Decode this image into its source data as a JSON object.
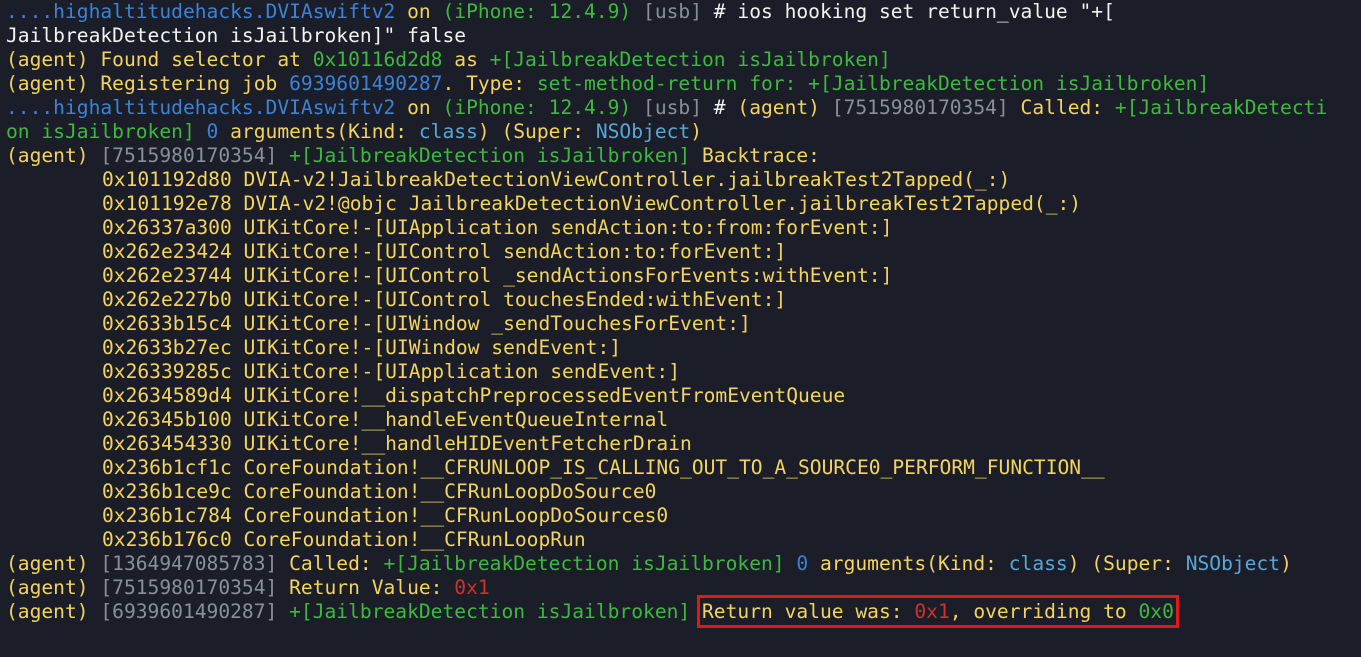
{
  "window": {
    "background": "#1b1e29"
  },
  "colors": {
    "blue": "#3b83d8",
    "green": "#3fb83f",
    "gray": "#8b8f99",
    "white": "#f2f2f2",
    "yellow": "#f2d45f",
    "red": "#d0312d",
    "cyan": "#59a7d6",
    "highlight_box": "#e01818"
  },
  "lines": [
    {
      "segs": [
        {
          "t": "....highaltitudehacks.DVIAswiftv2",
          "c": "blue"
        },
        {
          "t": " on ",
          "c": "yellow"
        },
        {
          "t": "(iPhone: 12.4.9)",
          "c": "green"
        },
        {
          "t": " [usb]",
          "c": "gray"
        },
        {
          "t": " # ios hooking set return_value \"+[",
          "c": "white"
        }
      ]
    },
    {
      "segs": [
        {
          "t": "JailbreakDetection isJailbroken]\" false",
          "c": "white"
        }
      ]
    },
    {
      "segs": [
        {
          "t": "(agent) Found selector at ",
          "c": "yellow"
        },
        {
          "t": "0x10116d2d8",
          "c": "green"
        },
        {
          "t": " as ",
          "c": "yellow"
        },
        {
          "t": "+[JailbreakDetection isJailbroken]",
          "c": "green"
        }
      ]
    },
    {
      "segs": [
        {
          "t": "(agent) Registering job ",
          "c": "yellow"
        },
        {
          "t": "6939601490287",
          "c": "blue"
        },
        {
          "t": ". Type: ",
          "c": "yellow"
        },
        {
          "t": "set-method-return for: +[JailbreakDetection isJailbroken]",
          "c": "green"
        }
      ]
    },
    {
      "segs": [
        {
          "t": "....highaltitudehacks.DVIAswiftv2",
          "c": "blue"
        },
        {
          "t": " on ",
          "c": "yellow"
        },
        {
          "t": "(iPhone: 12.4.9)",
          "c": "green"
        },
        {
          "t": " [usb]",
          "c": "gray"
        },
        {
          "t": " # ",
          "c": "white"
        },
        {
          "t": "(agent) ",
          "c": "yellow"
        },
        {
          "t": "[7515980170354]",
          "c": "gray"
        },
        {
          "t": " Called: ",
          "c": "yellow"
        },
        {
          "t": "+[JailbreakDetecti",
          "c": "green"
        }
      ]
    },
    {
      "segs": [
        {
          "t": "on isJailbroken]",
          "c": "green"
        },
        {
          "t": " 0",
          "c": "blue"
        },
        {
          "t": " arguments(Kind: ",
          "c": "yellow"
        },
        {
          "t": "class",
          "c": "cyan"
        },
        {
          "t": ") (Super: ",
          "c": "yellow"
        },
        {
          "t": "NSObject",
          "c": "cyan"
        },
        {
          "t": ")",
          "c": "yellow"
        }
      ]
    },
    {
      "segs": [
        {
          "t": "(agent) ",
          "c": "yellow"
        },
        {
          "t": "[7515980170354]",
          "c": "gray"
        },
        {
          "t": " +[JailbreakDetection isJailbroken]",
          "c": "green"
        },
        {
          "t": " Backtrace:",
          "c": "yellow"
        }
      ]
    },
    {
      "ind": true,
      "segs": [
        {
          "t": "0x101192d80 DVIA-v2!JailbreakDetectionViewController.jailbreakTest2Tapped(_:)",
          "c": "yellow"
        }
      ]
    },
    {
      "ind": true,
      "segs": [
        {
          "t": "0x101192e78 DVIA-v2!@objc JailbreakDetectionViewController.jailbreakTest2Tapped(_:)",
          "c": "yellow"
        }
      ]
    },
    {
      "ind": true,
      "segs": [
        {
          "t": "0x26337a300 UIKitCore!-[UIApplication sendAction:to:from:forEvent:]",
          "c": "yellow"
        }
      ]
    },
    {
      "ind": true,
      "segs": [
        {
          "t": "0x262e23424 UIKitCore!-[UIControl sendAction:to:forEvent:]",
          "c": "yellow"
        }
      ]
    },
    {
      "ind": true,
      "segs": [
        {
          "t": "0x262e23744 UIKitCore!-[UIControl _sendActionsForEvents:withEvent:]",
          "c": "yellow"
        }
      ]
    },
    {
      "ind": true,
      "segs": [
        {
          "t": "0x262e227b0 UIKitCore!-[UIControl touchesEnded:withEvent:]",
          "c": "yellow"
        }
      ]
    },
    {
      "ind": true,
      "segs": [
        {
          "t": "0x2633b15c4 UIKitCore!-[UIWindow _sendTouchesForEvent:]",
          "c": "yellow"
        }
      ]
    },
    {
      "ind": true,
      "segs": [
        {
          "t": "0x2633b27ec UIKitCore!-[UIWindow sendEvent:]",
          "c": "yellow"
        }
      ]
    },
    {
      "ind": true,
      "segs": [
        {
          "t": "0x26339285c UIKitCore!-[UIApplication sendEvent:]",
          "c": "yellow"
        }
      ]
    },
    {
      "ind": true,
      "segs": [
        {
          "t": "0x2634589d4 UIKitCore!__dispatchPreprocessedEventFromEventQueue",
          "c": "yellow"
        }
      ]
    },
    {
      "ind": true,
      "segs": [
        {
          "t": "0x26345b100 UIKitCore!__handleEventQueueInternal",
          "c": "yellow"
        }
      ]
    },
    {
      "ind": true,
      "segs": [
        {
          "t": "0x263454330 UIKitCore!__handleHIDEventFetcherDrain",
          "c": "yellow"
        }
      ]
    },
    {
      "ind": true,
      "segs": [
        {
          "t": "0x236b1cf1c CoreFoundation!__CFRUNLOOP_IS_CALLING_OUT_TO_A_SOURCE0_PERFORM_FUNCTION__",
          "c": "yellow"
        }
      ]
    },
    {
      "ind": true,
      "segs": [
        {
          "t": "0x236b1ce9c CoreFoundation!__CFRunLoopDoSource0",
          "c": "yellow"
        }
      ]
    },
    {
      "ind": true,
      "segs": [
        {
          "t": "0x236b1c784 CoreFoundation!__CFRunLoopDoSources0",
          "c": "yellow"
        }
      ]
    },
    {
      "ind": true,
      "segs": [
        {
          "t": "0x236b176c0 CoreFoundation!__CFRunLoopRun",
          "c": "yellow"
        }
      ]
    },
    {
      "segs": [
        {
          "t": "(agent) ",
          "c": "yellow"
        },
        {
          "t": "[1364947085783]",
          "c": "gray"
        },
        {
          "t": " Called: ",
          "c": "yellow"
        },
        {
          "t": "+[JailbreakDetection isJailbroken]",
          "c": "green"
        },
        {
          "t": " 0",
          "c": "blue"
        },
        {
          "t": " arguments(Kind: ",
          "c": "yellow"
        },
        {
          "t": "class",
          "c": "cyan"
        },
        {
          "t": ") (Super: ",
          "c": "yellow"
        },
        {
          "t": "NSObject",
          "c": "cyan"
        },
        {
          "t": ")",
          "c": "yellow"
        }
      ]
    },
    {
      "segs": [
        {
          "t": "(agent) ",
          "c": "yellow"
        },
        {
          "t": "[7515980170354]",
          "c": "gray"
        },
        {
          "t": " Return Value: ",
          "c": "yellow"
        },
        {
          "t": "0x1",
          "c": "red"
        }
      ]
    },
    {
      "segs": [
        {
          "t": "(agent) ",
          "c": "yellow"
        },
        {
          "t": "[6939601490287]",
          "c": "gray"
        },
        {
          "t": " +[JailbreakDetection isJailbroken]",
          "c": "green"
        },
        {
          "t": " ",
          "c": "yellow"
        },
        {
          "hl": true,
          "parts": [
            {
              "t": "Return value was: ",
              "c": "yellow"
            },
            {
              "t": "0x1",
              "c": "red"
            },
            {
              "t": ", overriding to ",
              "c": "yellow"
            },
            {
              "t": "0x0",
              "c": "green"
            }
          ]
        }
      ]
    }
  ]
}
